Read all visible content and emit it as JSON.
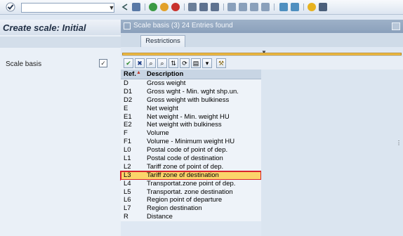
{
  "app": {
    "screen_title": "Create scale: Initial",
    "field_label": "Scale basis"
  },
  "popup": {
    "title": "Scale basis (3)   24 Entries found",
    "tab": "Restrictions",
    "columns": {
      "ref": "Ref.",
      "description": "Description"
    },
    "rows": [
      {
        "ref": "D",
        "desc": "Gross weight"
      },
      {
        "ref": "D1",
        "desc": "Gross wght - Min. wght shp.un."
      },
      {
        "ref": "D2",
        "desc": "Gross weight with bulkiness"
      },
      {
        "ref": "E",
        "desc": "Net weight"
      },
      {
        "ref": "E1",
        "desc": "Net weight - Min. weight HU"
      },
      {
        "ref": "E2",
        "desc": "Net weight with bulkiness"
      },
      {
        "ref": "F",
        "desc": "Volume"
      },
      {
        "ref": "F1",
        "desc": "Volume - Minimum weight HU"
      },
      {
        "ref": "L0",
        "desc": "Postal code of point of dep."
      },
      {
        "ref": "L1",
        "desc": "Postal code of destination"
      },
      {
        "ref": "L2",
        "desc": "Tariff zone of point of dep."
      },
      {
        "ref": "L3",
        "desc": "Tariff zone of destination"
      },
      {
        "ref": "L4",
        "desc": "Transportat.zone point of dep."
      },
      {
        "ref": "L5",
        "desc": "Transportat. zone destination"
      },
      {
        "ref": "L6",
        "desc": "Region point of departure"
      },
      {
        "ref": "L7",
        "desc": "Region destination"
      },
      {
        "ref": "R",
        "desc": "Distance"
      }
    ],
    "selected_ref": "L3"
  },
  "icons": {
    "toolbar": [
      "enter-icon",
      "back-icon",
      "save-icon",
      "exit-icon",
      "cancel-icon",
      "print-icon",
      "find-icon",
      "find-next-icon",
      "first-page-icon",
      "prev-page-icon",
      "next-page-icon",
      "last-page-icon",
      "create-session-icon",
      "shortcut-icon",
      "help-icon",
      "customize-icon"
    ]
  },
  "colors": {
    "selected_row": "#fbd46a",
    "selected_outline": "#d9232d"
  }
}
